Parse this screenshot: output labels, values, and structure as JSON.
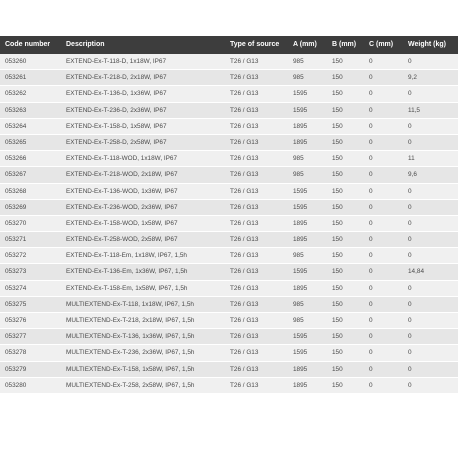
{
  "headers": [
    "Code number",
    "Description",
    "Type of source",
    "A (mm)",
    "B (mm)",
    "C (mm)",
    "Weight (kg)"
  ],
  "rows": [
    [
      "053260",
      "EXTEND-Ex-T-118-D, 1x18W, IP67",
      "T26 / G13",
      "985",
      "150",
      "0",
      "0"
    ],
    [
      "053261",
      "EXTEND-Ex-T-218-D, 2x18W, IP67",
      "T26 / G13",
      "985",
      "150",
      "0",
      "9,2"
    ],
    [
      "053262",
      "EXTEND-Ex-T-136-D, 1x36W, IP67",
      "T26 / G13",
      "1595",
      "150",
      "0",
      "0"
    ],
    [
      "053263",
      "EXTEND-Ex-T-236-D, 2x36W, IP67",
      "T26 / G13",
      "1595",
      "150",
      "0",
      "11,5"
    ],
    [
      "053264",
      "EXTEND-Ex-T-158-D, 1x58W, IP67",
      "T26 / G13",
      "1895",
      "150",
      "0",
      "0"
    ],
    [
      "053265",
      "EXTEND-Ex-T-258-D, 2x58W, IP67",
      "T26 / G13",
      "1895",
      "150",
      "0",
      "0"
    ],
    [
      "053266",
      "EXTEND-Ex-T-118-WOD, 1x18W, IP67",
      "T26 / G13",
      "985",
      "150",
      "0",
      "11"
    ],
    [
      "053267",
      "EXTEND-Ex-T-218-WOD, 2x18W, IP67",
      "T26 / G13",
      "985",
      "150",
      "0",
      "9,6"
    ],
    [
      "053268",
      "EXTEND-Ex-T-136-WOD, 1x36W, IP67",
      "T26 / G13",
      "1595",
      "150",
      "0",
      "0"
    ],
    [
      "053269",
      "EXTEND-Ex-T-236-WOD, 2x36W, IP67",
      "T26 / G13",
      "1595",
      "150",
      "0",
      "0"
    ],
    [
      "053270",
      "EXTEND-Ex-T-158-WOD, 1x58W, IP67",
      "T26 / G13",
      "1895",
      "150",
      "0",
      "0"
    ],
    [
      "053271",
      "EXTEND-Ex-T-258-WOD, 2x58W, IP67",
      "T26 / G13",
      "1895",
      "150",
      "0",
      "0"
    ],
    [
      "053272",
      "EXTEND-Ex-T-118-Em, 1x18W, IP67, 1,5h",
      "T26 / G13",
      "985",
      "150",
      "0",
      "0"
    ],
    [
      "053273",
      "EXTEND-Ex-T-136-Em, 1x36W, IP67, 1,5h",
      "T26 / G13",
      "1595",
      "150",
      "0",
      "14,84"
    ],
    [
      "053274",
      "EXTEND-Ex-T-158-Em, 1x58W, IP67, 1,5h",
      "T26 / G13",
      "1895",
      "150",
      "0",
      "0"
    ],
    [
      "053275",
      "MULTIEXTEND-Ex-T-118, 1x18W, IP67, 1,5h",
      "T26 / G13",
      "985",
      "150",
      "0",
      "0"
    ],
    [
      "053276",
      "MULTIEXTEND-Ex-T-218, 2x18W, IP67, 1,5h",
      "T26 / G13",
      "985",
      "150",
      "0",
      "0"
    ],
    [
      "053277",
      "MULTIEXTEND-Ex-T-136, 1x36W, IP67, 1,5h",
      "T26 / G13",
      "1595",
      "150",
      "0",
      "0"
    ],
    [
      "053278",
      "MULTIEXTEND-Ex-T-236, 2x36W, IP67, 1,5h",
      "T26 / G13",
      "1595",
      "150",
      "0",
      "0"
    ],
    [
      "053279",
      "MULTIEXTEND-Ex-T-158, 1x58W, IP67, 1,5h",
      "T26 / G13",
      "1895",
      "150",
      "0",
      "0"
    ],
    [
      "053280",
      "MULTIEXTEND-Ex-T-258, 2x58W, IP67, 1,5h",
      "T26 / G13",
      "1895",
      "150",
      "0",
      "0"
    ]
  ],
  "colors": {
    "header_bg": "#3d3d3d",
    "header_text": "#ffffff",
    "row_odd": "#f0f0f0",
    "row_even": "#e6e6e6",
    "body_text": "#4a4a4a"
  }
}
